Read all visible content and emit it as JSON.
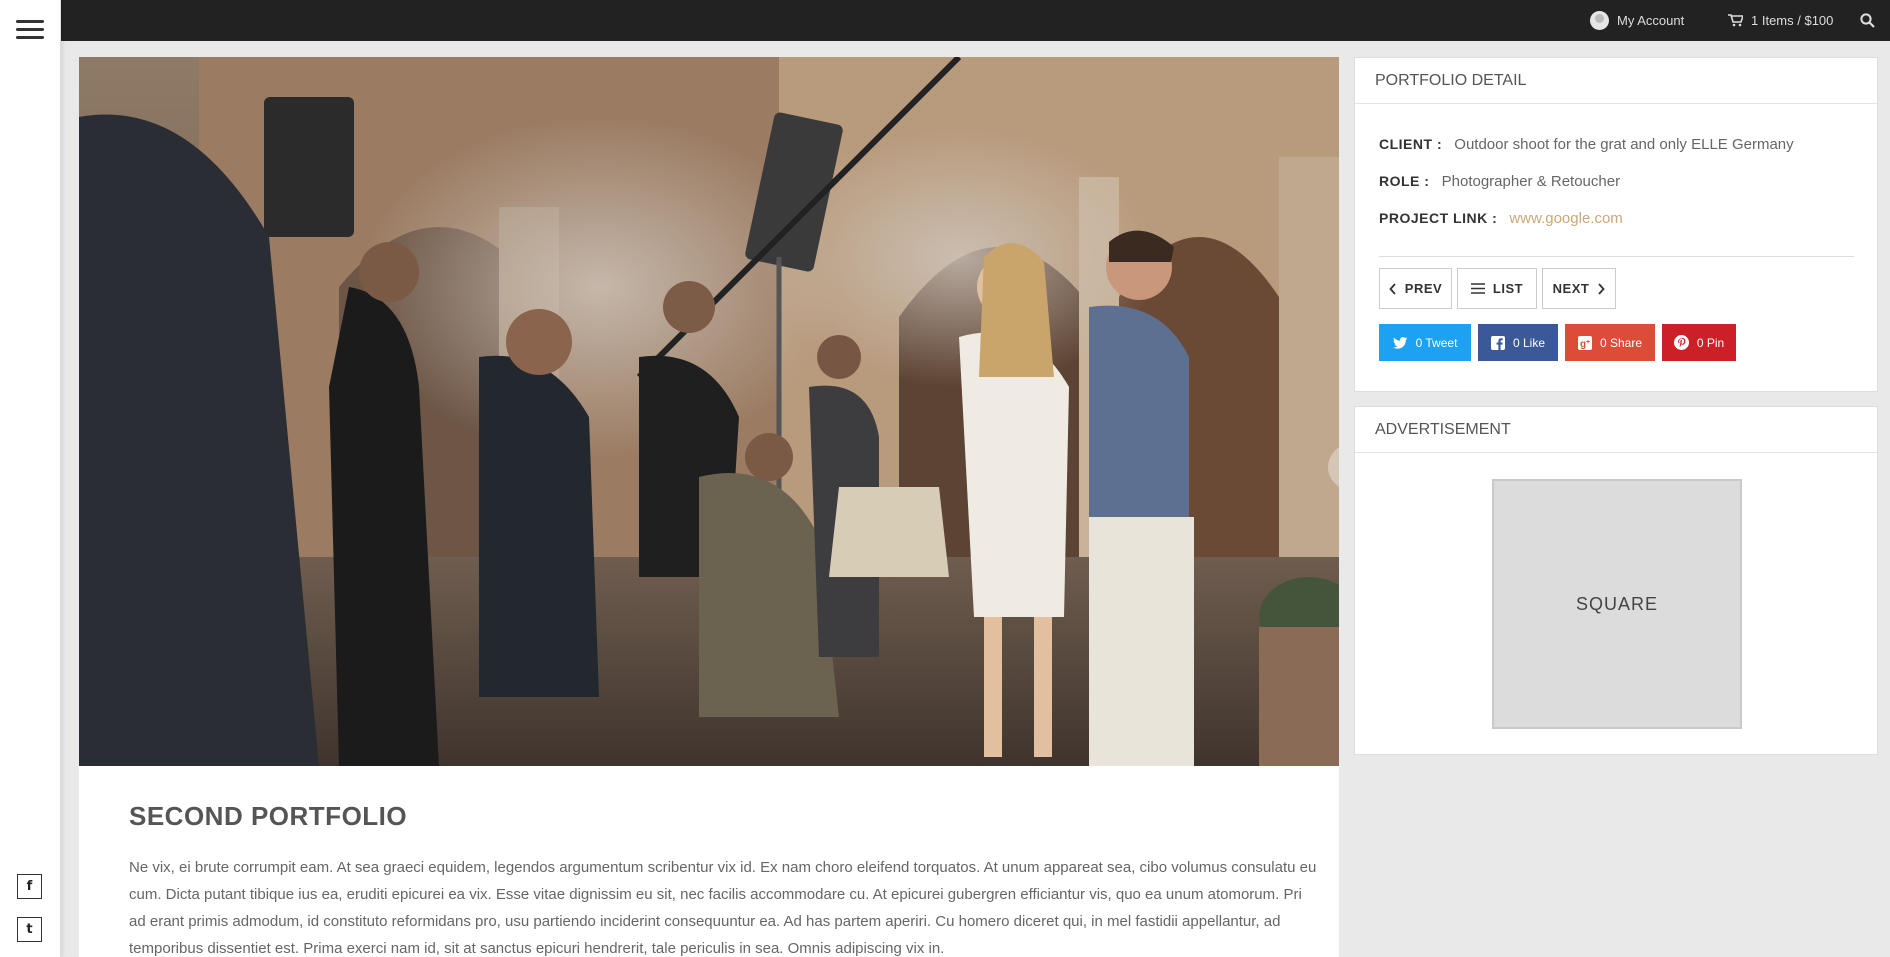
{
  "topbar": {
    "account_label": "My Account",
    "cart_label": "1 Items / $100"
  },
  "sidebar": {
    "social": [
      "f",
      "t"
    ]
  },
  "portfolio": {
    "title": "SECOND PORTFOLIO",
    "description": "Ne vix, ei brute corrumpit eam. At sea graeci equidem, legendos argumentum scribentur vix id. Ex nam choro eleifend torquatos. At unum appareat sea, cibo volumus consulatu eu cum. Dicta putant tibique ius ea, eruditi epicurei ea vix. Esse vitae dignissim eu sit, nec facilis accommodare cu. At epicurei gubergren efficiantur vis, quo ea unum atomorum. Pri ad erant primis admodum, id constituto reformidans pro, usu partiendo inciderint consequuntur ea. Ad has partem aperiri. Cu homero diceret qui, in mel fastidii appellantur, ad temporibus dissentiet est. Prima exerci nam id, sit at sanctus epicuri hendrerit, tale periculis in sea. Omnis adipiscing vix in."
  },
  "detail": {
    "heading": "PORTFOLIO DETAIL",
    "client_label": "CLIENT :",
    "client_value": "Outdoor shoot for the grat and only ELLE Germany",
    "role_label": "ROLE :",
    "role_value": "Photographer & Retoucher",
    "link_label": "PROJECT LINK :",
    "link_value": "www.google.com",
    "prev_label": "PREV",
    "list_label": "LIST",
    "next_label": "NEXT",
    "share": {
      "tweet": "0 Tweet",
      "like": "0 Like",
      "gshare": "0 Share",
      "pin": "0 Pin"
    },
    "colors": {
      "twitter": "#1da1f2",
      "facebook": "#3b5998",
      "google": "#dd4b39",
      "pinterest": "#cb2027",
      "link": "#c9a77b"
    }
  },
  "advertisement": {
    "heading": "ADVERTISEMENT",
    "box_label": "SQUARE"
  }
}
